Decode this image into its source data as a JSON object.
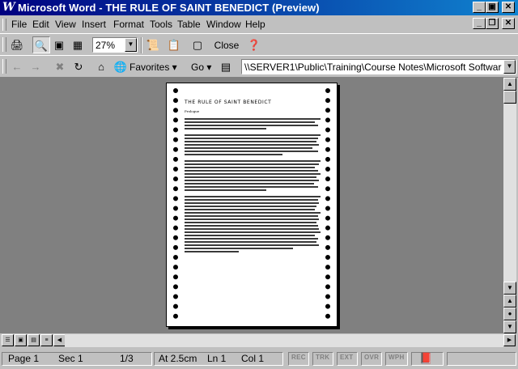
{
  "window": {
    "title": "Microsoft Word - THE RULE OF SAINT BENEDICT (Preview)",
    "app_icon": "W"
  },
  "menus": [
    "File",
    "Edit",
    "View",
    "Insert",
    "Format",
    "Tools",
    "Table",
    "Window",
    "Help"
  ],
  "preview_toolbar": {
    "zoom": "27%",
    "close_label": "Close"
  },
  "web_toolbar": {
    "favorites_label": "Favorites ▾",
    "go_label": "Go ▾",
    "address": "\\\\SERVER1\\Public\\Training\\Course Notes\\Microsoft Software\\Word"
  },
  "document": {
    "title": "THE RULE OF SAINT BENEDICT",
    "subtitle": "Prologue"
  },
  "statusbar": {
    "page": "Page 1",
    "sec": "Sec 1",
    "pages": "1/3",
    "at": "At  2.5cm",
    "ln": "Ln  1",
    "col": "Col  1",
    "modes": [
      "REC",
      "TRK",
      "EXT",
      "OVR",
      "WPH"
    ]
  },
  "colors": {
    "titlebar_start": "#000080",
    "titlebar_end": "#1084d0",
    "workspace": "#808080",
    "chrome": "#c0c0c0"
  }
}
